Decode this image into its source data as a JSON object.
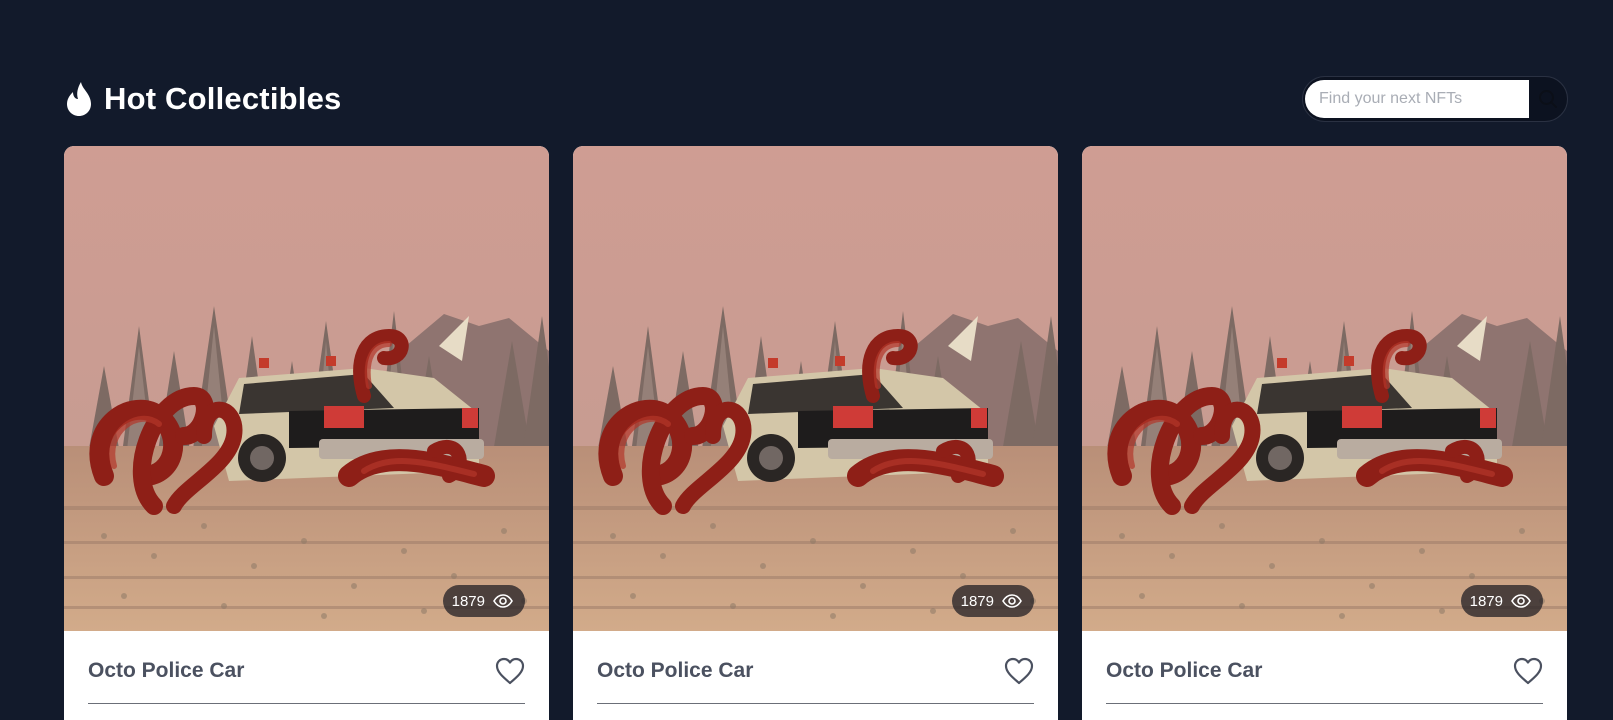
{
  "header": {
    "title": "Hot Collectibles",
    "icon": "flame-icon"
  },
  "search": {
    "placeholder": "Find your next NFTs",
    "value": "",
    "icon": "search-icon"
  },
  "colors": {
    "background": "#121a2b",
    "card": "#ffffff",
    "card_title": "#4b5160",
    "badge_bg": "#2e2a2e"
  },
  "cards": [
    {
      "name": "Octo Police Car",
      "views": "1879",
      "image": "octopus-police-car-artwork",
      "favorite_icon": "heart-outline-icon"
    },
    {
      "name": "Octo Police Car",
      "views": "1879",
      "image": "octopus-police-car-artwork",
      "favorite_icon": "heart-outline-icon"
    },
    {
      "name": "Octo Police Car",
      "views": "1879",
      "image": "octopus-police-car-artwork",
      "favorite_icon": "heart-outline-icon"
    }
  ]
}
